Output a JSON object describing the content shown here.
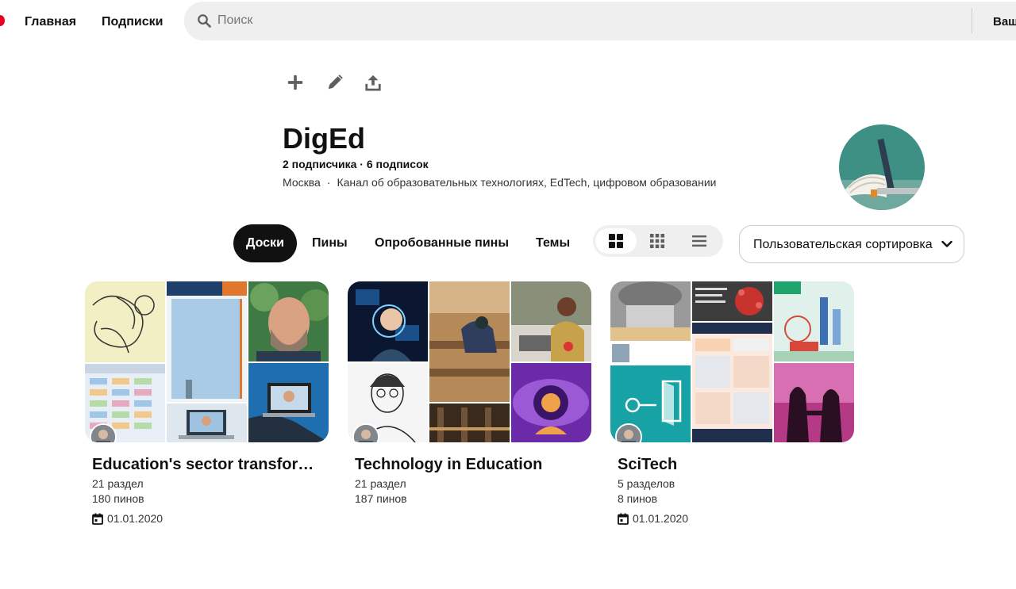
{
  "header": {
    "nav_home": "Главная",
    "nav_subscriptions": "Подписки",
    "search_placeholder": "Поиск",
    "cut_label": "Ваш"
  },
  "profile": {
    "name": "DigEd",
    "follow_stats": "2 подписчика · 6 подписок",
    "location": "Москва",
    "separator": "·",
    "description": "Канал об образовательных технологиях, EdTech, цифровом образовании"
  },
  "tabs": [
    {
      "label": "Доски",
      "active": true
    },
    {
      "label": "Пины",
      "active": false
    },
    {
      "label": "Опробованные пины",
      "active": false
    },
    {
      "label": "Темы",
      "active": false
    }
  ],
  "view_modes": [
    "grid-large-icon",
    "grid-small-icon",
    "list-icon"
  ],
  "sort": {
    "label": "Пользовательская сортировка"
  },
  "boards": [
    {
      "title": "Education's sector transformation",
      "sections": "21 раздел",
      "pins": "180 пинов",
      "date": "01.01.2020"
    },
    {
      "title": "Technology in Education",
      "sections": "21 раздел",
      "pins": "187 пинов",
      "date": ""
    },
    {
      "title": "SciTech",
      "sections": "5 разделов",
      "pins": "8 пинов",
      "date": "01.01.2020"
    }
  ],
  "colors": {
    "brand": "#e60023",
    "active_tab": "#111111",
    "search_bg": "#efefef"
  }
}
